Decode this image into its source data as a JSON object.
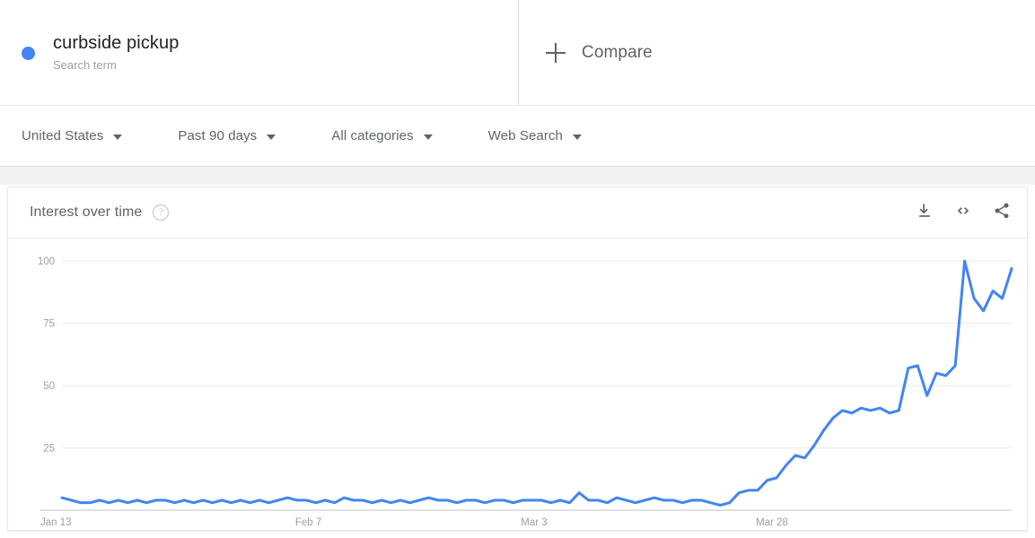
{
  "header": {
    "terms": [
      {
        "name": "curbside pickup",
        "type_label": "Search term",
        "color": "#4285f4",
        "dot_icon": "series-dot-icon"
      }
    ],
    "compare": {
      "label": "Compare",
      "icon": "plus-icon"
    }
  },
  "filters": [
    {
      "name": "region",
      "label": "United States"
    },
    {
      "name": "time-range",
      "label": "Past 90 days"
    },
    {
      "name": "category",
      "label": "All categories"
    },
    {
      "name": "search-type",
      "label": "Web Search"
    }
  ],
  "card": {
    "title": "Interest over time",
    "help_icon": "help-circle-icon",
    "help_glyph": "?",
    "actions": [
      {
        "name": "download-csv-button",
        "icon": "download-icon"
      },
      {
        "name": "embed-button",
        "icon": "embed-code-icon"
      },
      {
        "name": "share-button",
        "icon": "share-icon"
      }
    ]
  },
  "chart_data": {
    "type": "line",
    "title": "Interest over time",
    "xlabel": "",
    "ylabel": "",
    "ylim": [
      0,
      104
    ],
    "yticks": [
      25,
      50,
      75,
      100
    ],
    "ytick_labels": [
      "25",
      "50",
      "75",
      "100"
    ],
    "grid": true,
    "legend_position": "top",
    "line_color": "#4285f4",
    "line_width": 3,
    "xticks": [
      0,
      25,
      49,
      74
    ],
    "xtick_labels": [
      "Jan 13",
      "Feb 7",
      "Mar 3",
      "Mar 28"
    ],
    "series": [
      {
        "name": "curbside pickup",
        "color": "#4285f4",
        "values": [
          5,
          4,
          3,
          3,
          4,
          3,
          4,
          3,
          4,
          3,
          4,
          4,
          3,
          4,
          3,
          4,
          3,
          4,
          3,
          4,
          3,
          4,
          3,
          4,
          5,
          4,
          4,
          3,
          4,
          3,
          5,
          4,
          4,
          3,
          4,
          3,
          4,
          3,
          4,
          5,
          4,
          4,
          3,
          4,
          4,
          3,
          4,
          4,
          3,
          4,
          4,
          4,
          3,
          4,
          3,
          7,
          4,
          4,
          3,
          5,
          4,
          3,
          4,
          5,
          4,
          4,
          3,
          4,
          4,
          3,
          2,
          3,
          7,
          8,
          8,
          12,
          13,
          18,
          22,
          21,
          26,
          32,
          37,
          40,
          39,
          41,
          40,
          41,
          39,
          40,
          57,
          58,
          46,
          55,
          54,
          58,
          100,
          85,
          80,
          88,
          85,
          97
        ]
      }
    ]
  }
}
